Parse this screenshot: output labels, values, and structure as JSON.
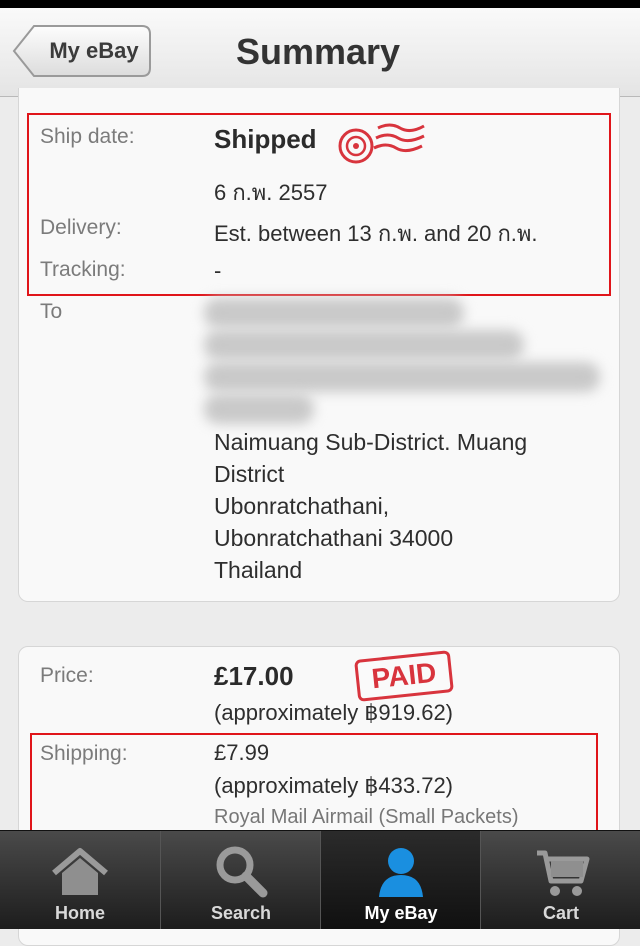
{
  "nav": {
    "back_label": "My eBay",
    "title": "Summary"
  },
  "shipping_info": {
    "ship_date_label": "Ship date:",
    "ship_status": "Shipped",
    "ship_date": "6 ก.พ. 2557",
    "delivery_label": "Delivery:",
    "delivery_value": "Est. between 13 ก.พ. and 20 ก.พ.",
    "tracking_label": "Tracking:",
    "tracking_value": "-",
    "to_label": "To",
    "address_lines": [
      "Naimuang Sub-District. Muang",
      "District",
      "Ubonratchathani,",
      "Ubonratchathani 34000",
      "Thailand"
    ]
  },
  "payment": {
    "price_label": "Price:",
    "price_value": "£17.00",
    "price_approx": "(approximately ฿919.62)",
    "paid_stamp": "PAID",
    "shipping_label": "Shipping:",
    "shipping_value": "£7.99",
    "shipping_approx": "(approximately ฿433.72)",
    "shipping_service": "Royal Mail Airmail (Small Packets)"
  },
  "tabs": [
    {
      "label": "Home",
      "icon": "home-icon"
    },
    {
      "label": "Search",
      "icon": "search-icon"
    },
    {
      "label": "My eBay",
      "icon": "user-icon",
      "active": true
    },
    {
      "label": "Cart",
      "icon": "cart-icon"
    }
  ],
  "colors": {
    "highlight": "#e0151a",
    "paid_stamp": "#d8343d",
    "active_tab_icon": "#1a8fe0"
  }
}
